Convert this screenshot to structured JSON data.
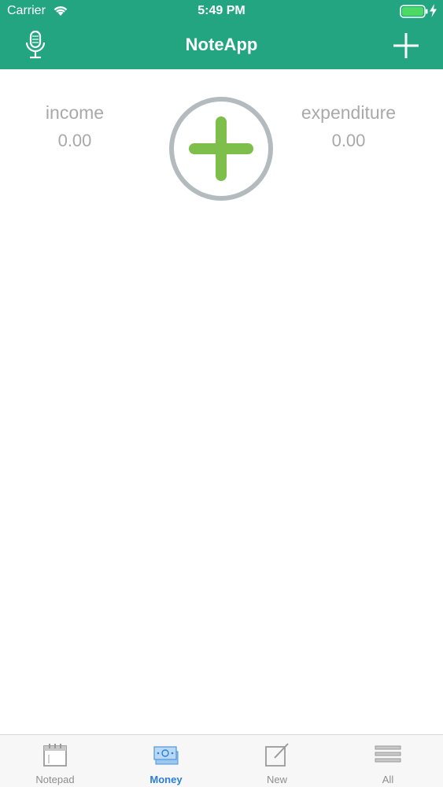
{
  "status_bar": {
    "carrier": "Carrier",
    "time": "5:49 PM"
  },
  "nav": {
    "title": "NoteApp",
    "left_icon": "microphone-icon",
    "right_icon": "plus-icon"
  },
  "summary": {
    "income_label": "income",
    "income_value": "0.00",
    "expenditure_label": "expenditure",
    "expenditure_value": "0.00"
  },
  "tabs": [
    {
      "label": "Notepad",
      "icon": "calendar-icon",
      "active": false
    },
    {
      "label": "Money",
      "icon": "money-icon",
      "active": true
    },
    {
      "label": "New",
      "icon": "compose-icon",
      "active": false
    },
    {
      "label": "All",
      "icon": "list-icon",
      "active": false
    }
  ],
  "colors": {
    "header": "#23a582",
    "accent_green": "#7dbf4a",
    "tab_active": "#2a7fd4",
    "summary_text": "#a9a9a9"
  }
}
